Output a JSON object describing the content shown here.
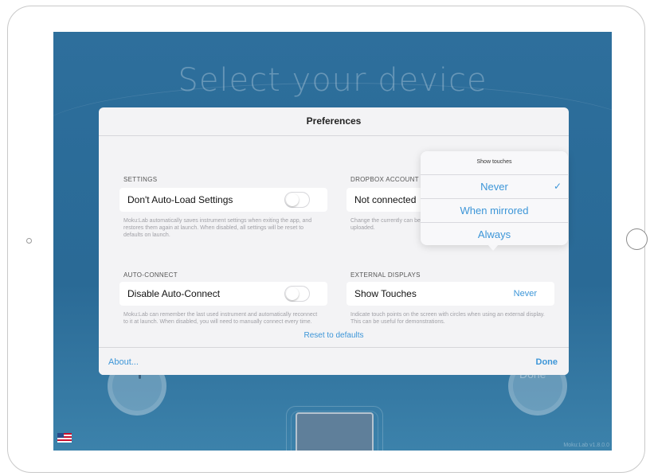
{
  "screen": {
    "title": "Select your device",
    "version": "Moku:Lab v1.8.0.0",
    "device_button_right": "Done"
  },
  "preferences": {
    "title": "Preferences",
    "settings": {
      "section": "SETTINGS",
      "label": "Don't Auto-Load Settings",
      "toggle_on": false,
      "description": "Moku:Lab automatically saves instrument settings when exiting the app, and restores them again at launch. When disabled, all settings will be reset to defaults on launch."
    },
    "auto_connect": {
      "section": "AUTO-CONNECT",
      "label": "Disable Auto-Connect",
      "toggle_on": false,
      "description": "Moku:Lab can remember the last used instrument and automatically reconnect to it at launch. When disabled, you will need to manually connect every time."
    },
    "dropbox": {
      "section": "DROPBOX ACCOUNT",
      "label": "Not connected",
      "description": "Change the currently can be uploaded."
    },
    "external_displays": {
      "section": "EXTERNAL DISPLAYS",
      "label": "Show Touches",
      "value": "Never",
      "description": "Indicate touch points on the screen with circles when using an external display. This can be useful for demonstrations."
    },
    "reset_label": "Reset to defaults",
    "about_label": "About...",
    "done_label": "Done"
  },
  "popover": {
    "title": "Show touches",
    "options": [
      {
        "label": "Never",
        "selected": true
      },
      {
        "label": "When mirrored",
        "selected": false
      },
      {
        "label": "Always",
        "selected": false
      }
    ],
    "checkmark": "✓"
  },
  "colors": {
    "accent": "#3d96d8",
    "screen_bg": "#2b6c99",
    "panel_bg": "#f3f3f5"
  }
}
